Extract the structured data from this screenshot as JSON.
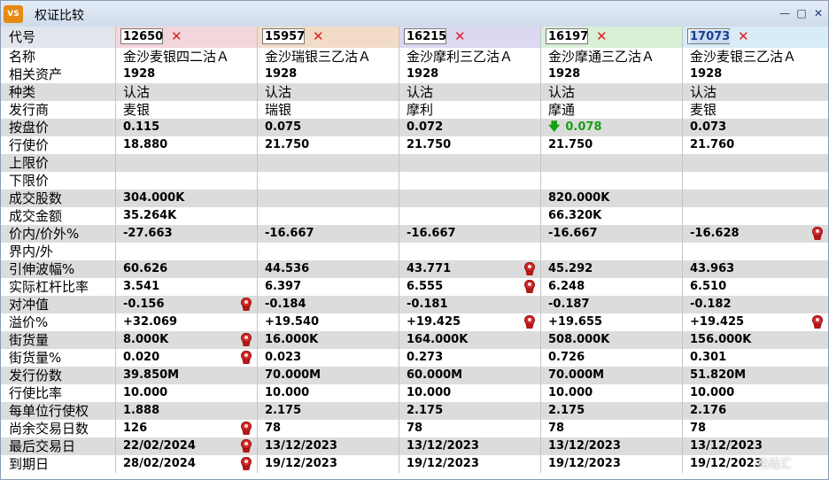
{
  "window": {
    "title": "权证比较",
    "app_icon": "VS",
    "minimize": "—",
    "maximize": "□",
    "close": "✕"
  },
  "header": {
    "label": "代号",
    "codes": [
      "12650",
      "15957",
      "16215",
      "16197",
      "17073"
    ],
    "remove": "✕",
    "col_colors": [
      "#f3d6dc",
      "#f2dcc8",
      "#dcd8f2",
      "#d8f0d6",
      "#d8ecf6"
    ]
  },
  "rows": [
    {
      "label": "名称",
      "cn": true,
      "values": [
        "金沙麦银四二沽Ａ",
        "金沙瑞银三乙沽Ａ",
        "金沙摩利三乙沽Ａ",
        "金沙摩通三乙沽Ａ",
        "金沙麦银三乙沽Ａ"
      ]
    },
    {
      "label": "相关资产",
      "values": [
        "1928",
        "1928",
        "1928",
        "1928",
        "1928"
      ]
    },
    {
      "label": "种类",
      "cn": true,
      "values": [
        "认沽",
        "认沽",
        "认沽",
        "认沽",
        "认沽"
      ]
    },
    {
      "label": "发行商",
      "cn": true,
      "values": [
        "麦银",
        "瑞银",
        "摩利",
        "摩通",
        "麦银"
      ]
    },
    {
      "label": "按盘价",
      "values": [
        "0.115",
        "0.075",
        "0.072",
        "0.078",
        "0.073"
      ],
      "green": [
        3
      ]
    },
    {
      "label": "行使价",
      "values": [
        "18.880",
        "21.750",
        "21.750",
        "21.750",
        "21.760"
      ]
    },
    {
      "label": "上限价",
      "values": [
        "",
        "",
        "",
        "",
        ""
      ]
    },
    {
      "label": "下限价",
      "values": [
        "",
        "",
        "",
        "",
        ""
      ]
    },
    {
      "label": "成交股数",
      "values": [
        "304.000K",
        "",
        "",
        "820.000K",
        ""
      ]
    },
    {
      "label": "成交金额",
      "values": [
        "35.264K",
        "",
        "",
        "66.320K",
        ""
      ]
    },
    {
      "label": "价内/价外%",
      "values": [
        "-27.663",
        "-16.667",
        "-16.667",
        "-16.667",
        "-16.628"
      ],
      "medal": [
        4
      ]
    },
    {
      "label": "界内/外",
      "values": [
        "",
        "",
        "",
        "",
        ""
      ]
    },
    {
      "label": "引伸波幅%",
      "values": [
        "60.626",
        "44.536",
        "43.771",
        "45.292",
        "43.963"
      ],
      "medal": [
        2
      ]
    },
    {
      "label": "实际杠杆比率",
      "values": [
        "3.541",
        "6.397",
        "6.555",
        "6.248",
        "6.510"
      ],
      "medal": [
        2
      ]
    },
    {
      "label": "对冲值",
      "values": [
        "-0.156",
        "-0.184",
        "-0.181",
        "-0.187",
        "-0.182"
      ],
      "medal": [
        0
      ]
    },
    {
      "label": "溢价%",
      "values": [
        "+32.069",
        "+19.540",
        "+19.425",
        "+19.655",
        "+19.425"
      ],
      "medal": [
        2,
        4
      ]
    },
    {
      "label": "街货量",
      "values": [
        "8.000K",
        "16.000K",
        "164.000K",
        "508.000K",
        "156.000K"
      ],
      "medal": [
        0
      ]
    },
    {
      "label": "街货量%",
      "values": [
        "0.020",
        "0.023",
        "0.273",
        "0.726",
        "0.301"
      ],
      "medal": [
        0
      ]
    },
    {
      "label": "发行份数",
      "values": [
        "39.850M",
        "70.000M",
        "60.000M",
        "70.000M",
        "51.820M"
      ]
    },
    {
      "label": "行使比率",
      "values": [
        "10.000",
        "10.000",
        "10.000",
        "10.000",
        "10.000"
      ]
    },
    {
      "label": "每单位行使权",
      "values": [
        "1.888",
        "2.175",
        "2.175",
        "2.175",
        "2.176"
      ]
    },
    {
      "label": "尚余交易日数",
      "values": [
        "126",
        "78",
        "78",
        "78",
        "78"
      ],
      "medal": [
        0
      ]
    },
    {
      "label": "最后交易日",
      "values": [
        "22/02/2024",
        "13/12/2023",
        "13/12/2023",
        "13/12/2023",
        "13/12/2023"
      ],
      "medal": [
        0
      ]
    },
    {
      "label": "到期日",
      "values": [
        "28/02/2024",
        "19/12/2023",
        "19/12/2023",
        "19/12/2023",
        "19/12/2023"
      ],
      "medal": [
        0
      ]
    }
  ],
  "watermark": "格隆汇"
}
